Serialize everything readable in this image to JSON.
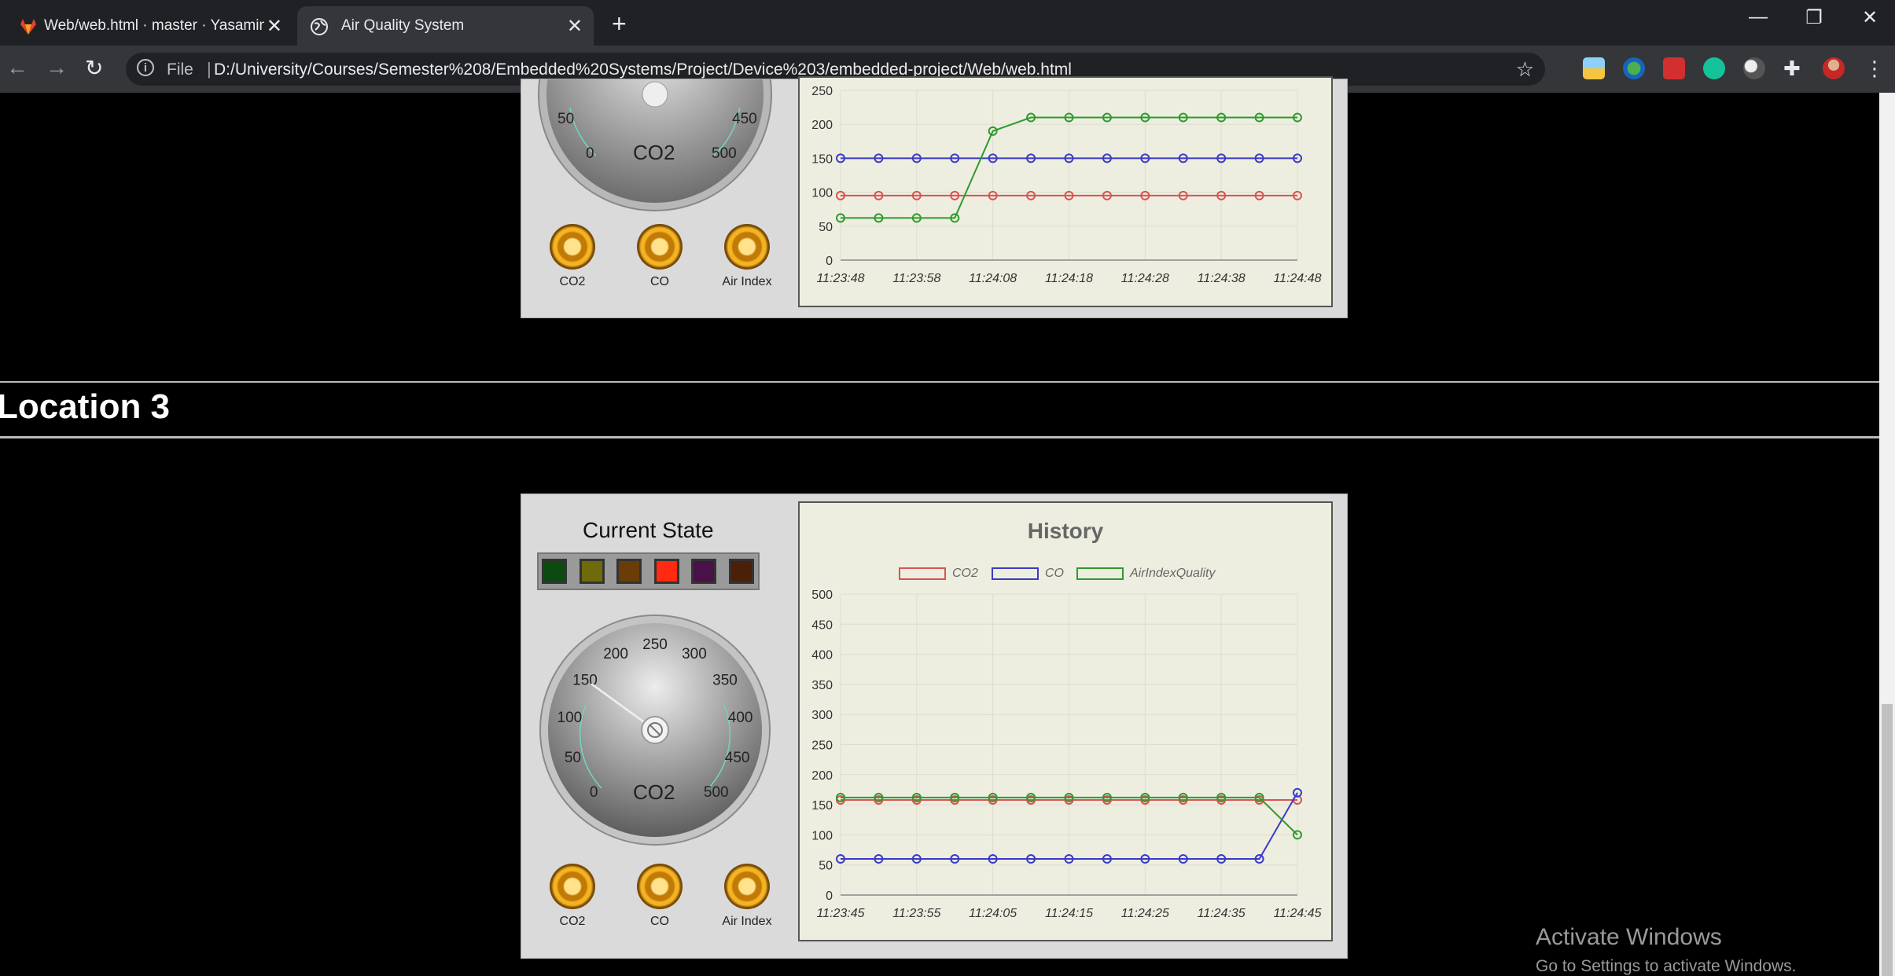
{
  "browser": {
    "tabs": [
      {
        "title": "Web/web.html · master · Yasamin",
        "active": false,
        "icon": "gitlab-icon"
      },
      {
        "title": "Air Quality System",
        "active": true,
        "icon": "globe-icon"
      }
    ],
    "new_tab_icon": "+",
    "window_controls": {
      "minimize": "—",
      "restore": "❐",
      "close": "✕"
    },
    "nav": {
      "back": "←",
      "forward": "→",
      "reload": "↻"
    },
    "address": {
      "scheme": "File",
      "url": "D:/University/Courses/Semester%208/Embedded%20Systems/Project/Device%203/embedded-project/Web/web.html"
    }
  },
  "location2": {
    "gauge": {
      "label": "CO2",
      "visible_ticks": [
        "50",
        "0",
        "450",
        "500"
      ]
    },
    "knobs": [
      "CO2",
      "CO",
      "Air Index"
    ],
    "chart_data": {
      "type": "line",
      "x": [
        "11:23:48",
        "11:23:53",
        "11:23:58",
        "11:24:03",
        "11:24:08",
        "11:24:13",
        "11:24:18",
        "11:24:23",
        "11:24:28",
        "11:24:33",
        "11:24:38",
        "11:24:43",
        "11:24:48"
      ],
      "x_tick_labels": [
        "11:23:48",
        "11:23:58",
        "11:24:08",
        "11:24:18",
        "11:24:28",
        "11:24:38",
        "11:24:48"
      ],
      "y_tick_labels": [
        "0",
        "50",
        "100",
        "150",
        "200",
        "250"
      ],
      "ylim": [
        0,
        250
      ],
      "series": [
        {
          "name": "CO2",
          "color": "#d9534f",
          "values": [
            95,
            95,
            95,
            95,
            95,
            95,
            95,
            95,
            95,
            95,
            95,
            95,
            95
          ]
        },
        {
          "name": "CO",
          "color": "#3a3ac8",
          "values": [
            150,
            150,
            150,
            150,
            150,
            150,
            150,
            150,
            150,
            150,
            150,
            150,
            150
          ]
        },
        {
          "name": "AirIndexQuality",
          "color": "#2e9a2e",
          "values": [
            62,
            62,
            62,
            62,
            190,
            210,
            210,
            210,
            210,
            210,
            210,
            210,
            210
          ]
        }
      ],
      "grid": true
    }
  },
  "location3": {
    "heading": "Location 3",
    "current_state": {
      "title": "Current State",
      "lights": [
        {
          "color": "#0c4a12"
        },
        {
          "color": "#6f6a0a"
        },
        {
          "color": "#6a3c08"
        },
        {
          "color": "#ff2a10"
        },
        {
          "color": "#4a1048"
        },
        {
          "color": "#4a2008"
        }
      ]
    },
    "gauge": {
      "label": "CO2",
      "ticks": [
        "0",
        "50",
        "100",
        "150",
        "200",
        "250",
        "300",
        "350",
        "400",
        "450",
        "500"
      ],
      "value": 150,
      "max": 500
    },
    "knobs": [
      "CO2",
      "CO",
      "Air Index"
    ],
    "chart_data": {
      "type": "line",
      "title": "History",
      "legend": [
        "CO2",
        "CO",
        "AirIndexQuality"
      ],
      "legend_position": "top",
      "x": [
        "11:23:45",
        "11:23:50",
        "11:23:55",
        "11:24:00",
        "11:24:05",
        "11:24:10",
        "11:24:15",
        "11:24:20",
        "11:24:25",
        "11:24:30",
        "11:24:35",
        "11:24:40",
        "11:24:45"
      ],
      "x_tick_labels": [
        "11:23:45",
        "11:23:55",
        "11:24:05",
        "11:24:15",
        "11:24:25",
        "11:24:35",
        "11:24:45"
      ],
      "y_tick_labels": [
        "0",
        "50",
        "100",
        "150",
        "200",
        "250",
        "300",
        "350",
        "400",
        "450",
        "500"
      ],
      "ylim": [
        0,
        500
      ],
      "series": [
        {
          "name": "CO2",
          "color": "#d9534f",
          "values": [
            158,
            158,
            158,
            158,
            158,
            158,
            158,
            158,
            158,
            158,
            158,
            158,
            158
          ]
        },
        {
          "name": "CO",
          "color": "#3a3ac8",
          "values": [
            60,
            60,
            60,
            60,
            60,
            60,
            60,
            60,
            60,
            60,
            60,
            60,
            170
          ]
        },
        {
          "name": "AirIndexQuality",
          "color": "#2e9a2e",
          "values": [
            162,
            162,
            162,
            162,
            162,
            162,
            162,
            162,
            162,
            162,
            162,
            162,
            100
          ]
        }
      ],
      "grid": true
    }
  },
  "watermark": {
    "line1": "Activate Windows",
    "line2": "Go to Settings to activate Windows."
  }
}
